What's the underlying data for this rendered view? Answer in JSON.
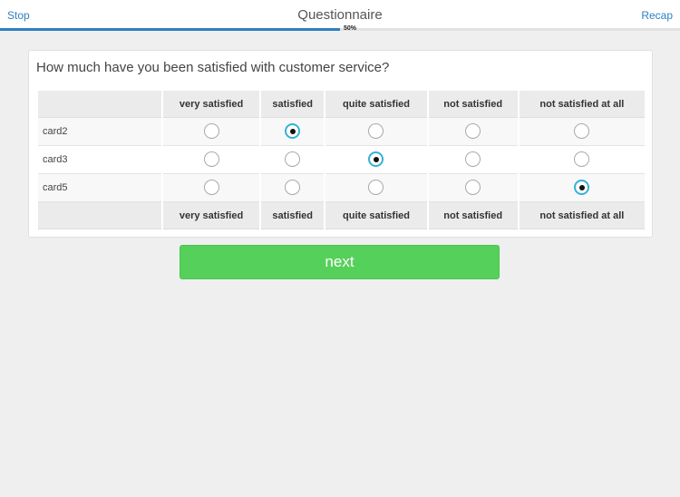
{
  "header": {
    "stop_label": "Stop",
    "title": "Questionnaire",
    "recap_label": "Recap",
    "progress_label": "50%",
    "progress_fraction": 0.5
  },
  "question": {
    "text": "How much have you been satisfied with customer service?",
    "columns": [
      "very satisfied",
      "satisfied",
      "quite satisfied",
      "not satisfied",
      "not satisfied at all"
    ],
    "rows": [
      {
        "label": "card2",
        "selected_index": 1
      },
      {
        "label": "card3",
        "selected_index": 2
      },
      {
        "label": "card5",
        "selected_index": 4
      }
    ]
  },
  "footer": {
    "next_label": "next"
  },
  "colors": {
    "accent": "#2f7fc1",
    "radio_checked_ring": "#36b1d6",
    "next_button": "#55d05a"
  }
}
